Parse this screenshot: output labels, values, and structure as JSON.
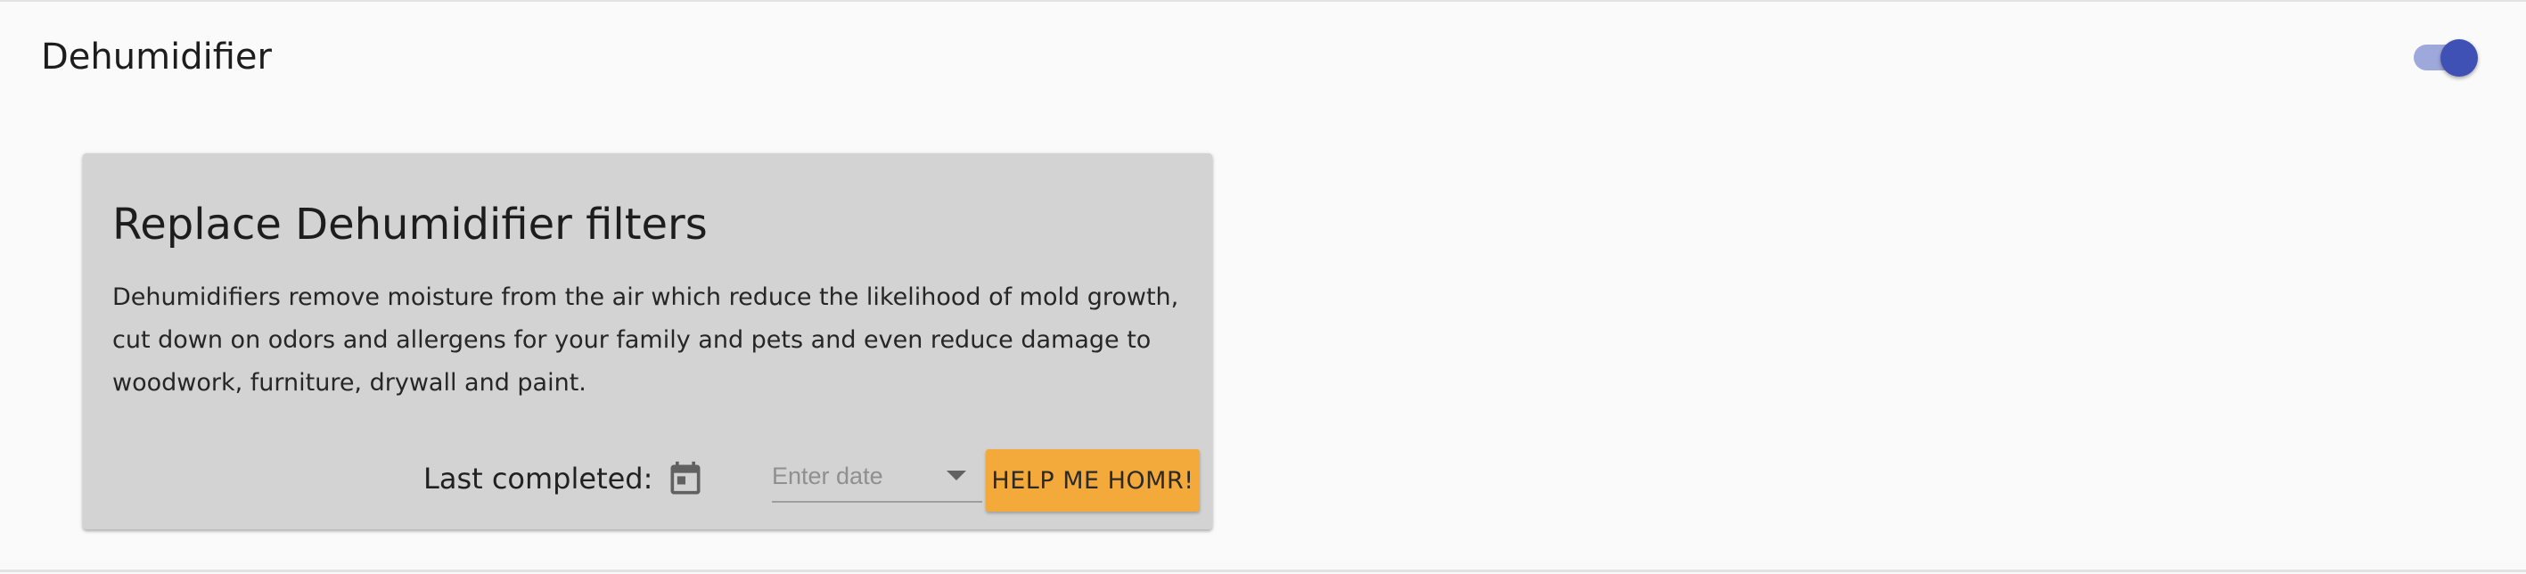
{
  "section": {
    "title": "Dehumidifier",
    "toggle_on": true
  },
  "card": {
    "title": "Replace Dehumidifier filters",
    "description": "Dehumidifiers remove moisture from the air which reduce the likelihood of mold growth, cut down on odors and allergens for your family and pets and even reduce damage to woodwork, furniture, drywall and paint.",
    "last_completed_label": "Last completed:",
    "date_placeholder": "Enter date",
    "date_value": "",
    "help_button_label": "HELP ME HOMR!"
  },
  "icons": {
    "calendar": "calendar-icon",
    "dropdown": "chevron-down-icon"
  },
  "colors": {
    "background": "#fafafa",
    "card_background": "#d3d3d3",
    "toggle_thumb": "#3f51b5",
    "toggle_track": "#9fa8da",
    "accent_button": "#f4a93b"
  }
}
